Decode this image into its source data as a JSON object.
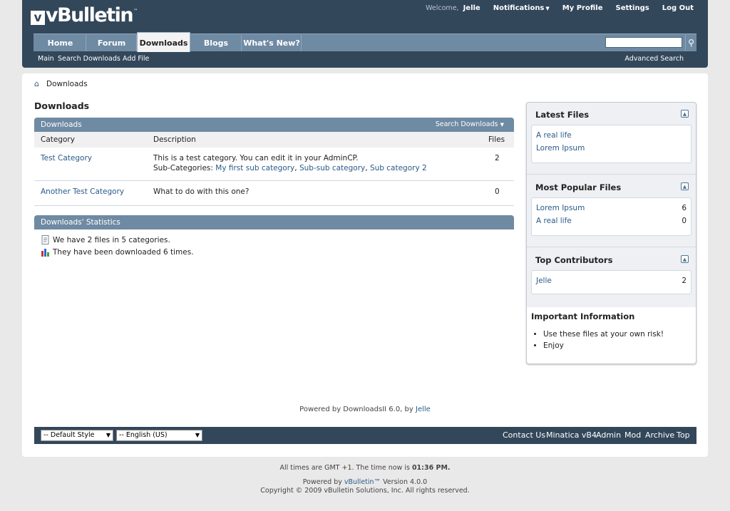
{
  "header": {
    "logo_text": "vBulletin",
    "logo_check": "v",
    "logo_tm": "™",
    "welcome": "Welcome,",
    "username": "Jelle",
    "notifications": "Notifications",
    "my_profile": "My Profile",
    "settings": "Settings",
    "log_out": "Log Out"
  },
  "nav": {
    "tabs": [
      {
        "label": "Home"
      },
      {
        "label": "Forum"
      },
      {
        "label": "Downloads"
      },
      {
        "label": "Blogs"
      },
      {
        "label": "What's New?"
      }
    ],
    "search_value": "",
    "subnav": [
      {
        "label": "Main"
      },
      {
        "label": "Search Downloads"
      },
      {
        "label": "Add File"
      }
    ],
    "advanced_search": "Advanced Search"
  },
  "breadcrumb": {
    "current": "Downloads"
  },
  "page_title": "Downloads",
  "downloads_block": {
    "title": "Downloads",
    "search_link": "Search Downloads",
    "columns": {
      "category": "Category",
      "description": "Description",
      "files": "Files"
    },
    "rows": [
      {
        "category": "Test Category",
        "description": "This is a test category. You can edit it in your AdminCP.",
        "subcat_label": "Sub-Categories:",
        "subcats": [
          "My first sub category",
          "Sub-sub category",
          "Sub category 2"
        ],
        "files": "2"
      },
      {
        "category": "Another Test Category",
        "description": "What to do with this one?",
        "files": "0"
      }
    ]
  },
  "stats_block": {
    "title": "Downloads' Statistics",
    "line1": "We have 2 files in 5 categories.",
    "line2": "They have been downloaded 6 times."
  },
  "sidebar": {
    "latest": {
      "title": "Latest Files",
      "items": [
        "A real life",
        "Lorem Ipsum"
      ]
    },
    "popular": {
      "title": "Most Popular Files",
      "items": [
        {
          "name": "Lorem Ipsum",
          "count": "6"
        },
        {
          "name": "A real life",
          "count": "0"
        }
      ]
    },
    "contributors": {
      "title": "Top Contributors",
      "items": [
        {
          "name": "Jelle",
          "count": "2"
        }
      ]
    },
    "important": {
      "title": "Important Information",
      "items": [
        "Use these files at your own risk!",
        "Enjoy"
      ]
    }
  },
  "powered": {
    "prefix": "Powered by DownloadsII 6.0, by",
    "author": "Jelle"
  },
  "footer": {
    "style_select": "-- Default Style",
    "lang_select": "-- English (US)",
    "links": [
      "Contact Us",
      "Minatica vB4",
      "Admin",
      "Mod",
      "Archive",
      "Top"
    ]
  },
  "time_info": {
    "prefix": "All times are GMT +1. The time now is",
    "time": "01:36 PM."
  },
  "copyright": {
    "powered_prefix": "Powered by",
    "vb_link": "vBulletin™",
    "version": "Version 4.0.0",
    "line2": "Copyright © 2009 vBulletin Solutions, Inc. All rights reserved."
  },
  "colors": {
    "header": "#33475a",
    "nav": "#6f8aa3",
    "link": "#2a5a8a"
  }
}
